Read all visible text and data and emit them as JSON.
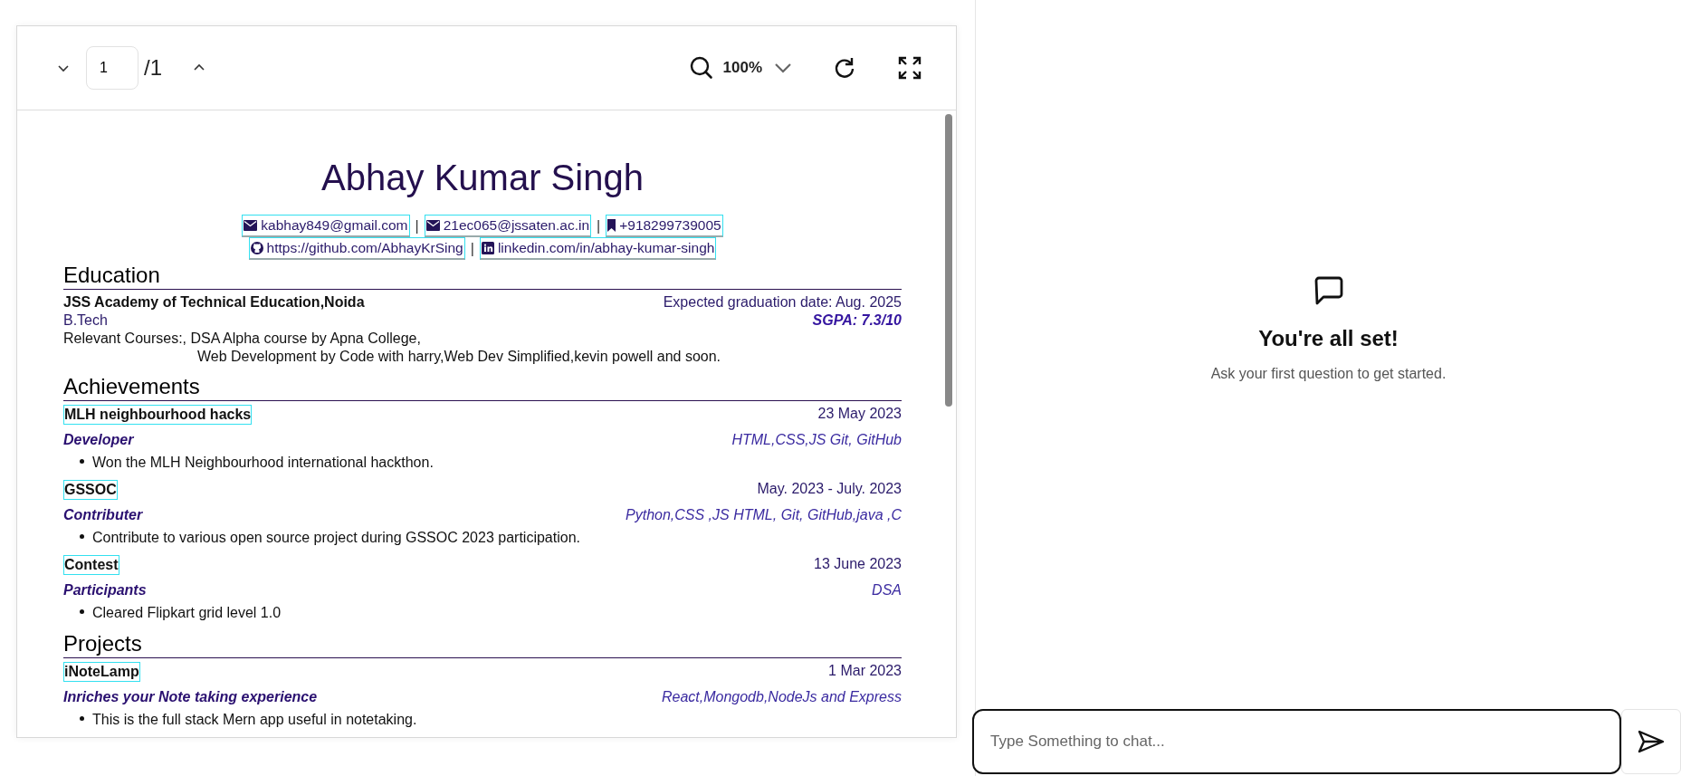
{
  "viewer": {
    "page_input": "1",
    "page_total": "/1",
    "zoom": "100%"
  },
  "resume": {
    "name": "Abhay Kumar Singh",
    "contact_lines": [
      [
        {
          "kind": "email",
          "text": "kabhay849@gmail.com"
        },
        {
          "kind": "separator",
          "text": "|"
        },
        {
          "kind": "email",
          "text": "21ec065@jssaten.ac.in"
        },
        {
          "kind": "separator",
          "text": "|"
        },
        {
          "kind": "phone",
          "text": "+918299739005"
        }
      ],
      [
        {
          "kind": "github",
          "text": "https://github.com/AbhayKrSing"
        },
        {
          "kind": "separator",
          "text": "|"
        },
        {
          "kind": "linkedin",
          "text": "linkedin.com/in/abhay-kumar-singh"
        }
      ]
    ],
    "education": {
      "heading": "Education",
      "institution": "JSS Academy of Technical Education,Noida",
      "date": "Expected graduation date: Aug. 2025",
      "degree": "B.Tech",
      "grade": "SGPA: 7.3/10",
      "courses": [
        "Relevant Courses:, DSA Alpha course by Apna College,",
        "Web Development by Code with harry,Web Dev Simplified,kevin powell and soon."
      ]
    },
    "sections": [
      {
        "heading": "Achievements",
        "entries": [
          {
            "title": "MLH neighbourhood hacks",
            "date": "23 May 2023",
            "role": "Developer",
            "tech": "HTML,CSS,JS Git, GitHub",
            "bullets": [
              "Won the MLH Neighbourhood international hackthon."
            ]
          },
          {
            "title": "GSSOC",
            "date": "May. 2023 - July. 2023",
            "role": "Contributer",
            "tech": "Python,CSS ,JS HTML, Git, GitHub,java ,C",
            "bullets": [
              "Contribute to various open source project during GSSOC 2023 participation."
            ]
          },
          {
            "title": "Contest",
            "date": "13 June 2023",
            "role": "Participants",
            "tech": "DSA",
            "bullets": [
              "Cleared Flipkart grid level 1.0"
            ]
          }
        ]
      },
      {
        "heading": "Projects",
        "entries": [
          {
            "title": "iNoteLamp",
            "date": "1 Mar 2023",
            "role": "Inriches your Note taking experience",
            "tech": "React,Mongodb,NodeJs and Express",
            "bullets": [
              "This is the full stack Mern app useful in notetaking."
            ]
          }
        ]
      }
    ]
  },
  "chat": {
    "title": "You're all set!",
    "subtitle": "Ask your first question to get started.",
    "input": {
      "placeholder": "Type Something to chat..."
    }
  }
}
